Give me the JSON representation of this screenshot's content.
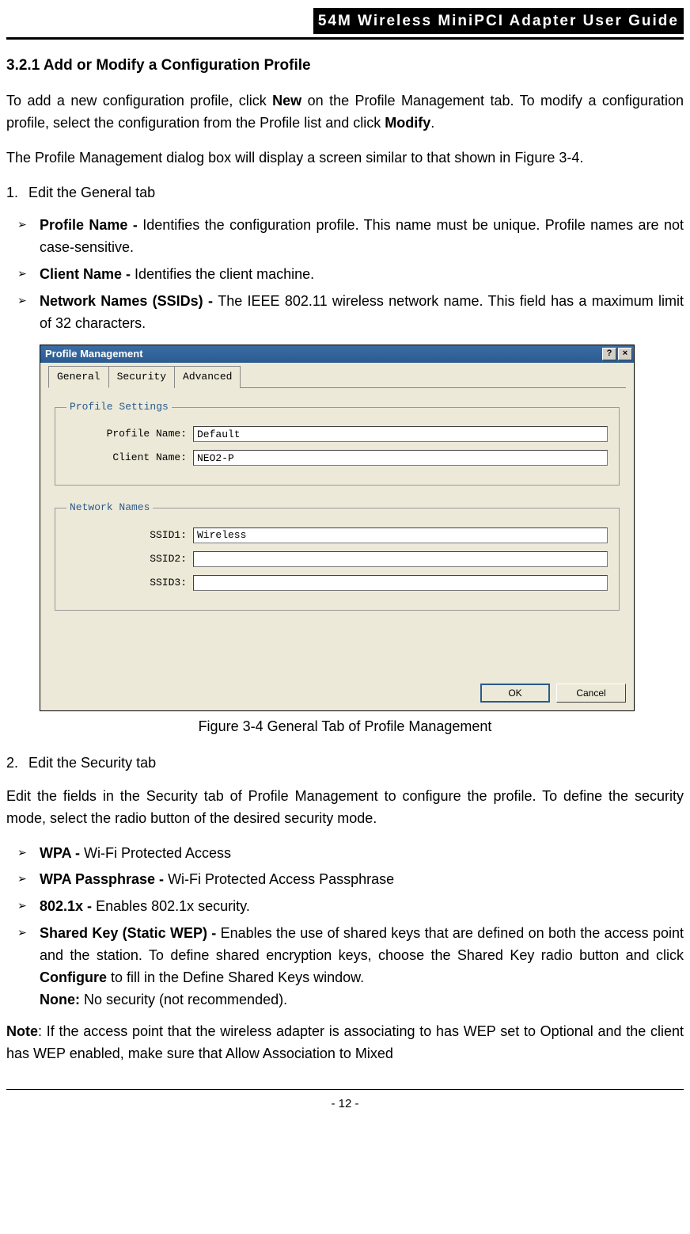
{
  "header": {
    "title": "54M Wireless MiniPCI Adapter User Guide"
  },
  "section": {
    "heading": "3.2.1 Add or Modify a Configuration Profile"
  },
  "para1": {
    "pre_new": "To add a new configuration profile, click ",
    "new_bold": "New",
    "mid": " on the Profile Management tab. To modify a configuration profile, select the configuration from the Profile list and click ",
    "modify_bold": "Modify",
    "tail": "."
  },
  "para2": "The Profile Management dialog box will display a screen similar to that shown in Figure 3-4.",
  "step1": {
    "num": "1.",
    "text": "Edit the General tab"
  },
  "list1": {
    "i1": {
      "b": "Profile Name - ",
      "t": "Identifies the configuration profile. This name must be unique. Profile names are not case-sensitive."
    },
    "i2": {
      "b": "Client Name - ",
      "t": "Identifies the client machine."
    },
    "i3": {
      "b": "Network Names (SSIDs) - ",
      "t": "The IEEE 802.11 wireless network name. This field has a maximum limit of 32 characters."
    }
  },
  "dialog": {
    "title": "Profile Management",
    "help_glyph": "?",
    "close_glyph": "×",
    "tabs": {
      "general": "General",
      "security": "Security",
      "advanced": "Advanced"
    },
    "group_profile": {
      "legend": "Profile Settings",
      "profile_name_label": "Profile Name:",
      "profile_name_value": "Default",
      "client_name_label": "Client Name:",
      "client_name_value": "NEO2-P"
    },
    "group_network": {
      "legend": "Network Names",
      "ssid1_label": "SSID1:",
      "ssid1_value": "Wireless",
      "ssid2_label": "SSID2:",
      "ssid2_value": "",
      "ssid3_label": "SSID3:",
      "ssid3_value": ""
    },
    "buttons": {
      "ok": "OK",
      "cancel": "Cancel"
    }
  },
  "figure_caption": "Figure 3-4    General Tab of Profile Management",
  "step2": {
    "num": "2.",
    "text": "Edit the Security tab"
  },
  "para3": "Edit the fields in the Security tab of Profile Management to configure the profile. To define the security mode, select the radio button of the desired security mode.",
  "list2": {
    "i1": {
      "b": "WPA - ",
      "t": "Wi-Fi Protected Access"
    },
    "i2": {
      "b": "WPA Passphrase - ",
      "t": "Wi-Fi Protected Access Passphrase"
    },
    "i3": {
      "b": "802.1x - ",
      "t": "Enables 802.1x security."
    },
    "i4": {
      "b": "Shared Key (Static WEP) - ",
      "pre": "Enables the use of shared keys that are defined on both the access point and the station. To define shared encryption keys, choose the Shared Key radio button and click ",
      "cfg": "Configure",
      "post": " to fill in the Define Shared Keys window.",
      "none_b": "None:",
      "none_t": " No security (not recommended)."
    }
  },
  "note": {
    "b": "Note",
    "t": ": If the access point that the wireless adapter is associating to has WEP set to Optional and the client has WEP enabled, make sure that Allow Association to Mixed"
  },
  "footer": {
    "page": "- 12 -"
  }
}
